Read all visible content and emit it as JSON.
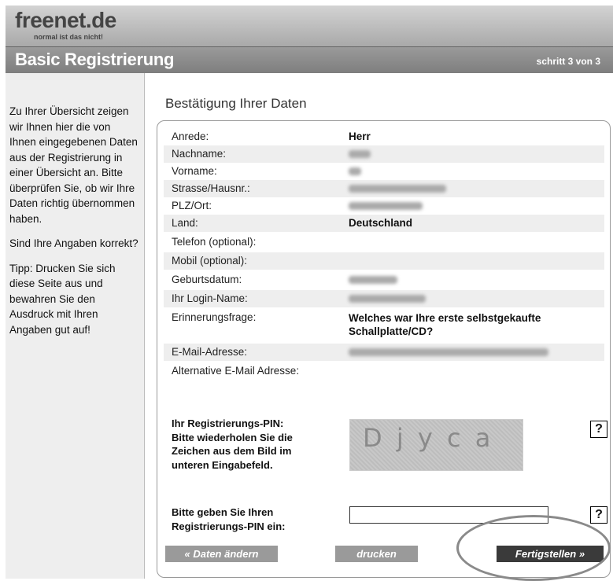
{
  "header": {
    "logo": "freenet.de",
    "tagline": "normal ist das nicht!",
    "title": "Basic Registrierung",
    "step": "schritt 3 von 3"
  },
  "sidebar": {
    "p1": "Zu Ihrer Übersicht zeigen wir Ihnen hier die von Ihnen eingegebenen Daten aus der Registrierung in einer Übersicht an. Bitte überprüfen Sie, ob wir Ihre Daten richtig übernommen haben.",
    "p2": "Sind Ihre Angaben korrekt?",
    "p3": "Tipp: Drucken Sie sich diese Seite aus und bewahren Sie den Ausdruck mit Ihren Angaben gut auf!"
  },
  "main": {
    "section_title": "Bestätigung Ihrer Daten",
    "fields": {
      "anrede": {
        "label": "Anrede:",
        "value": "Herr"
      },
      "nachname": {
        "label": "Nachname:"
      },
      "vorname": {
        "label": "Vorname:"
      },
      "strasse": {
        "label": "Strasse/Hausnr.:"
      },
      "plz": {
        "label": "PLZ/Ort:"
      },
      "land": {
        "label": "Land:",
        "value": "Deutschland"
      },
      "telefon": {
        "label": "Telefon (optional):"
      },
      "mobil": {
        "label": "Mobil (optional):"
      },
      "geburtsdatum": {
        "label": "Geburtsdatum:"
      },
      "login": {
        "label": "Ihr Login-Name:"
      },
      "frage": {
        "label": "Erinnerungsfrage:",
        "value_line1": "Welches war Ihre erste selbstgekaufte",
        "value_line2": "Schallplatte/CD?"
      },
      "email": {
        "label": "E-Mail-Adresse:"
      },
      "alt_email": {
        "label": "Alternative E-Mail Adresse:"
      }
    },
    "pin": {
      "label_lines": [
        "Ihr Registrierungs-PIN:",
        "Bitte wiederholen Sie die",
        "Zeichen aus dem Bild im",
        "unteren Eingabefeld."
      ],
      "captcha_text": "D j y c a",
      "help": "?"
    },
    "pin_input": {
      "label_lines": [
        "Bitte geben Sie Ihren",
        "Registrierungs-PIN ein:"
      ],
      "value": "",
      "help": "?"
    },
    "buttons": {
      "back": "« Daten ändern",
      "print": "drucken",
      "finish": "Fertigstellen »"
    }
  }
}
